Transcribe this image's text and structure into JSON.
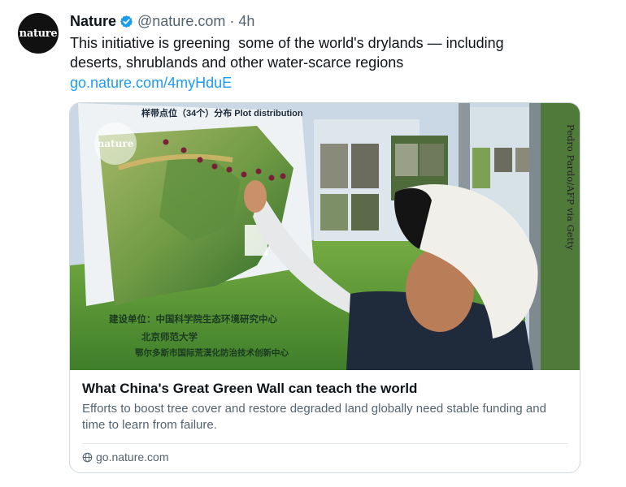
{
  "author": {
    "avatar_text": "nature",
    "name": "Nature",
    "handle": "@nature.com",
    "separator": "·",
    "time": "4h"
  },
  "post": {
    "text": "This initiative is greening  some of the world's drylands — including\ndeserts, shrublands and other water-scarce regions",
    "link": "go.nature.com/4myHduE"
  },
  "card": {
    "image_watermark": "nature",
    "image_credit": "Pedro Pardo/AFP via Getty",
    "map_title": "样带点位（34个）分布 Plot distribution",
    "sign_lines": [
      "建设单位：中国科学院生态环境研究中心",
      "北京师范大学",
      "鄂尔多斯市国际荒漠化防治技术创新中心"
    ],
    "title": "What China's Great Green Wall can teach the world",
    "description": "Efforts to boost tree cover and restore degraded land globally need stable funding and time to learn from failure.",
    "domain": "go.nature.com"
  },
  "colors": {
    "link": "#1d9bf0",
    "verified": "#1d9bf0",
    "secondary_text": "#536471"
  },
  "icons": [
    "verified-badge-icon",
    "globe-icon"
  ]
}
